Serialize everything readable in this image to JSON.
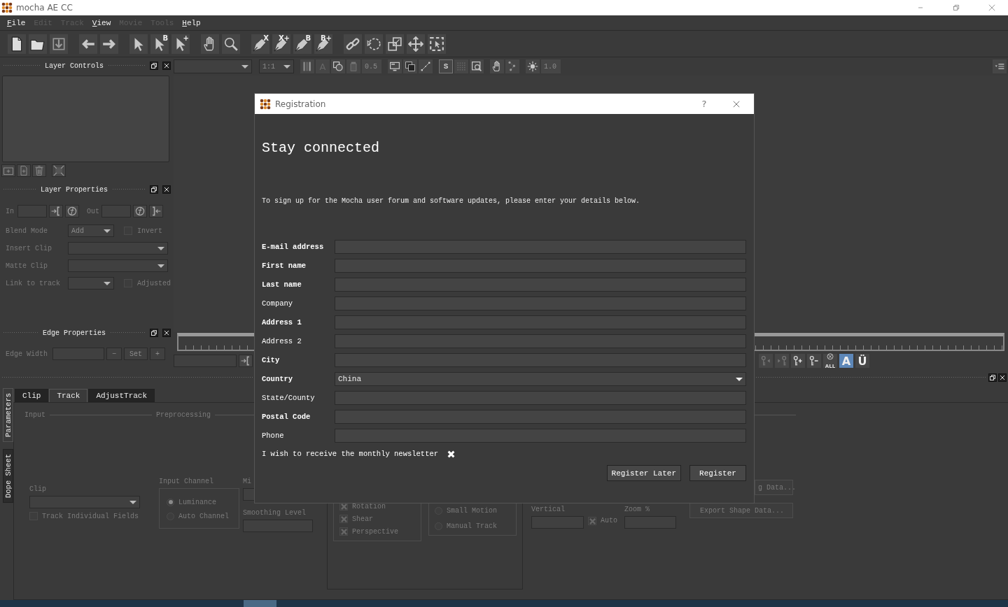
{
  "window": {
    "title": "mocha AE CC"
  },
  "menu": [
    {
      "label": "File",
      "disabled": false
    },
    {
      "label": "Edit",
      "disabled": true
    },
    {
      "label": "Track",
      "disabled": true
    },
    {
      "label": "View",
      "disabled": false
    },
    {
      "label": "Movie",
      "disabled": true
    },
    {
      "label": "Tools",
      "disabled": true
    },
    {
      "label": "Help",
      "disabled": false
    }
  ],
  "tool_badges": [
    "B",
    "+",
    "X",
    "X+",
    "B",
    "B+"
  ],
  "view_toolbar": {
    "zoom": "1:1",
    "text_tool": "A",
    "opacity": "0.5",
    "stabilize": "S",
    "gain": "1.0"
  },
  "layer_controls": {
    "title": "Layer Controls"
  },
  "layer_properties": {
    "title": "Layer Properties",
    "in_label": "In",
    "out_label": "Out",
    "blend_mode": {
      "label": "Blend Mode",
      "value": "Add"
    },
    "invert": {
      "label": "Invert",
      "checked": false
    },
    "insert_clip": {
      "label": "Insert Clip"
    },
    "matte_clip": {
      "label": "Matte Clip"
    },
    "link_to_track": {
      "label": "Link to track"
    },
    "adjusted": {
      "label": "Adjusted",
      "checked": false
    }
  },
  "edge_properties": {
    "title": "Edge Properties",
    "label": "Edge Width",
    "buttons": [
      "−",
      "Set",
      "+"
    ]
  },
  "key_buttons": [
    {
      "kind": "prev-key"
    },
    {
      "kind": "next-key"
    },
    {
      "kind": "add-key"
    },
    {
      "kind": "remove-key"
    },
    {
      "kind": "clear-all",
      "text": "ALL"
    }
  ],
  "view_toggles": [
    {
      "label": "A",
      "on": true
    },
    {
      "label": "Ü",
      "on": false
    }
  ],
  "side_tabs": [
    {
      "label": "Parameters",
      "selected": true
    },
    {
      "label": "Dope Sheet",
      "selected": false
    }
  ],
  "tabs": [
    {
      "label": "Clip",
      "selected": false
    },
    {
      "label": "Track",
      "selected": true
    },
    {
      "label": "AdjustTrack",
      "selected": false
    }
  ],
  "track_params": {
    "input_heading": "Input",
    "preprocessing_heading": "Preprocessing",
    "clip_label": "Clip",
    "track_fields": {
      "label": "Track Individual Fields",
      "checked": false
    },
    "input_channel_label": "Input Channel",
    "channels": [
      {
        "label": "Luminance",
        "selected": true
      },
      {
        "label": "Auto Channel",
        "selected": false
      }
    ],
    "column_3_label": "Mi",
    "smoothing_label": "Smoothing Level",
    "motion": [
      {
        "label": "Rotation",
        "checked": true
      },
      {
        "label": "Shear",
        "checked": true
      },
      {
        "label": "Perspective",
        "checked": true
      }
    ],
    "search_modes": [
      {
        "label": "Small Motion",
        "selected": false
      },
      {
        "label": "Manual Track",
        "selected": false
      }
    ],
    "vertical_label": "Vertical",
    "auto": {
      "label": "Auto",
      "checked": true
    },
    "zoom_label": "Zoom %",
    "buttons": [
      "g Data...",
      "Export Shape Data..."
    ]
  },
  "dialog": {
    "title": "Registration",
    "help": "?",
    "heading": "Stay connected",
    "intro": "To sign up for the Mocha user forum and software updates, please enter your details below.",
    "fields": [
      {
        "label": "E-mail address",
        "required": true,
        "kind": "text"
      },
      {
        "label": "First name",
        "required": true,
        "kind": "text"
      },
      {
        "label": "Last name",
        "required": true,
        "kind": "text"
      },
      {
        "label": "Company",
        "required": false,
        "kind": "text"
      },
      {
        "label": "Address 1",
        "required": true,
        "kind": "text"
      },
      {
        "label": "Address 2",
        "required": false,
        "kind": "text"
      },
      {
        "label": "City",
        "required": true,
        "kind": "text"
      },
      {
        "label": "Country",
        "required": true,
        "kind": "select",
        "value": "China"
      },
      {
        "label": "State/County",
        "required": false,
        "kind": "text"
      },
      {
        "label": "Postal Code",
        "required": true,
        "kind": "text"
      },
      {
        "label": "Phone",
        "required": false,
        "kind": "text"
      }
    ],
    "newsletter": {
      "label": "I wish to receive the monthly newsletter",
      "checked": true
    },
    "buttons": [
      "Register Later",
      "Register"
    ]
  }
}
